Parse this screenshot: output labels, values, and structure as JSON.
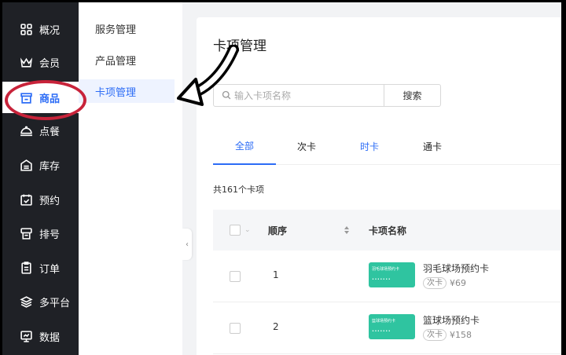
{
  "nav": {
    "items": [
      {
        "label": "概况",
        "icon": "grid-icon"
      },
      {
        "label": "会员",
        "icon": "crown-icon"
      },
      {
        "label": "商品",
        "icon": "shop-icon"
      },
      {
        "label": "点餐",
        "icon": "dish-icon"
      },
      {
        "label": "库存",
        "icon": "inventory-icon"
      },
      {
        "label": "预约",
        "icon": "calendar-icon"
      },
      {
        "label": "排号",
        "icon": "queue-icon"
      },
      {
        "label": "订单",
        "icon": "order-icon"
      },
      {
        "label": "多平台",
        "icon": "layers-icon"
      },
      {
        "label": "数据",
        "icon": "monitor-icon"
      }
    ],
    "active_index": 2
  },
  "subnav": {
    "items": [
      "服务管理",
      "产品管理",
      "卡项管理"
    ],
    "active_index": 2
  },
  "page": {
    "title": "卡项管理",
    "search_placeholder": "输入卡项名称",
    "search_button": "搜索",
    "tabs": [
      "全部",
      "次卡",
      "时卡",
      "通卡"
    ],
    "total_text": "共161个卡项"
  },
  "table": {
    "headers": {
      "order": "顺序",
      "name": "卡项名称"
    },
    "rows": [
      {
        "order": "1",
        "thumb_text": "羽毛球场预约卡",
        "name": "羽毛球场预约卡",
        "tag": "次卡",
        "price": "¥69"
      },
      {
        "order": "2",
        "thumb_text": "篮球场预约卡",
        "name": "篮球场预约卡",
        "tag": "次卡",
        "price": "¥158"
      }
    ]
  },
  "colors": {
    "accent": "#2c6cf6",
    "nav_bg": "#1f2126",
    "thumb": "#2fc4a0",
    "annotation": "#c8233a"
  }
}
